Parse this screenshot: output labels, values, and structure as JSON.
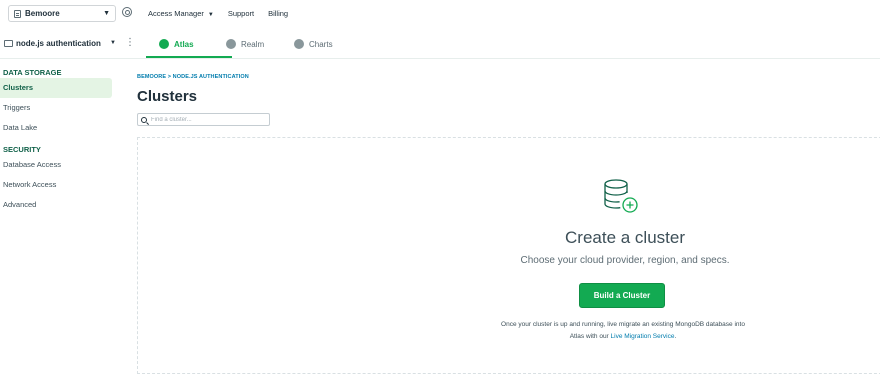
{
  "topbar": {
    "org_name": "Bemoore",
    "nav": [
      {
        "label": "Access Manager",
        "has_caret": true
      },
      {
        "label": "Support"
      },
      {
        "label": "Billing"
      }
    ]
  },
  "projectbar": {
    "project_name": "node.js authentication",
    "tabs": [
      {
        "label": "Atlas",
        "active": true,
        "icon": "atlas-icon"
      },
      {
        "label": "Realm",
        "active": false,
        "icon": "realm-icon"
      },
      {
        "label": "Charts",
        "active": false,
        "icon": "charts-icon"
      }
    ]
  },
  "sidebar": {
    "section1_heading": "DATA STORAGE",
    "section1_items": [
      "Clusters",
      "Triggers",
      "Data Lake"
    ],
    "section2_heading": "SECURITY",
    "section2_items": [
      "Database Access",
      "Network Access",
      "Advanced"
    ]
  },
  "main": {
    "breadcrumb": "BEMOORE > NODE.JS AUTHENTICATION",
    "title": "Clusters",
    "search_placeholder": "Find a cluster...",
    "empty_title": "Create a cluster",
    "empty_subtitle": "Choose your cloud provider, region, and specs.",
    "build_button": "Build a Cluster",
    "help_line1": "Once your cluster is up and running, live migrate an existing MongoDB database into",
    "help_line2_prefix": "Atlas with our ",
    "help_link": "Live Migration Service",
    "help_line2_suffix": "."
  },
  "colors": {
    "accent_green": "#13aa52",
    "link_blue": "#007cad",
    "sidebar_heading": "#116149"
  }
}
